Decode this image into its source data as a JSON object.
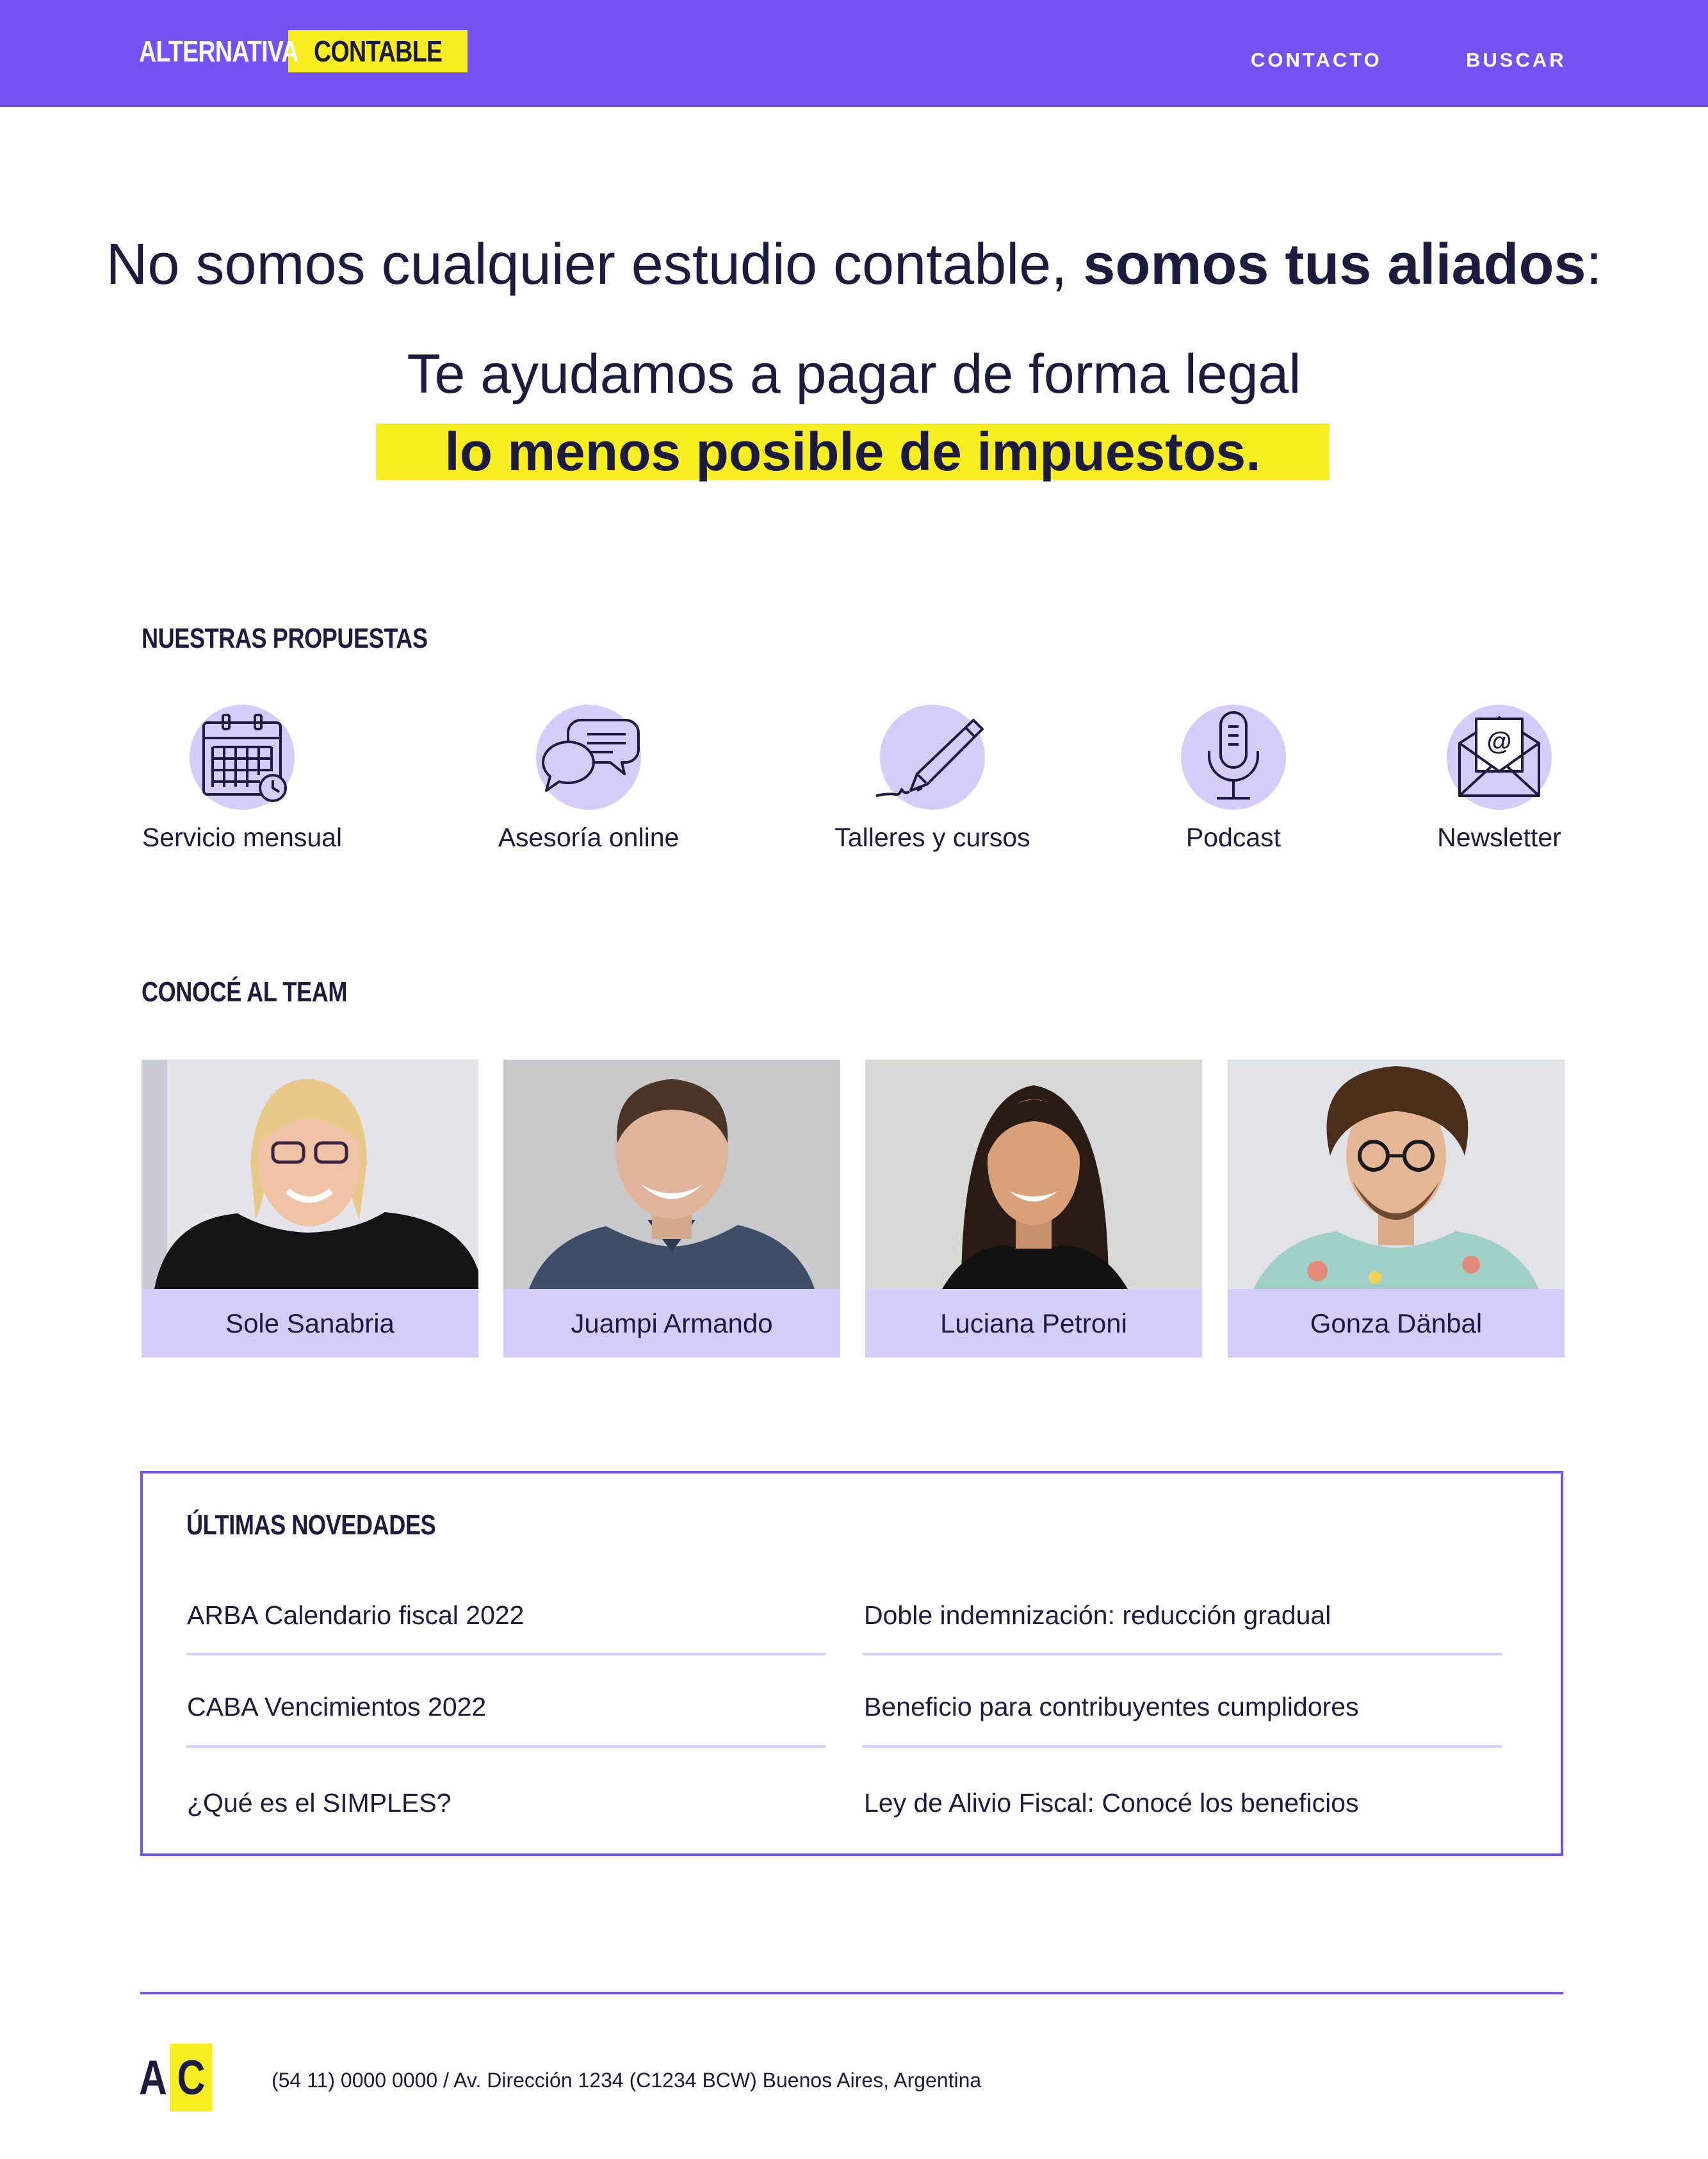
{
  "colors": {
    "brand_purple": "#7552ef",
    "highlight_yellow": "#f8ee22",
    "light_purple": "#d6ccfb",
    "text_dark": "#1c1a3d"
  },
  "header": {
    "logo_left": "ALTERNATIVA",
    "logo_right": "CONTABLE",
    "nav": [
      "CONTACTO",
      "BUSCAR"
    ]
  },
  "hero": {
    "line1_regular": "No somos cualquier estudio contable, ",
    "line1_bold": "somos tus aliados",
    "line1_colon": ":",
    "line2": "Te ayudamos a pagar de forma legal",
    "highlight": "lo menos posible de impuestos."
  },
  "services": {
    "title": "NUESTRAS PROPUESTAS",
    "items": [
      {
        "label": "Servicio mensual",
        "icon": "calendar-icon"
      },
      {
        "label": "Asesoría online",
        "icon": "chat-bubbles-icon"
      },
      {
        "label": "Talleres y cursos",
        "icon": "pencil-icon"
      },
      {
        "label": "Podcast",
        "icon": "microphone-icon"
      },
      {
        "label": "Newsletter",
        "icon": "envelope-icon"
      }
    ]
  },
  "team": {
    "title": "CONOCÉ AL TEAM",
    "members": [
      {
        "name": "Sole Sanabria"
      },
      {
        "name": "Juampi Armando"
      },
      {
        "name": "Luciana Petroni"
      },
      {
        "name": "Gonza Dänbal"
      }
    ]
  },
  "news": {
    "title": "ÚLTIMAS NOVEDADES",
    "items": [
      "ARBA Calendario fiscal 2022",
      "Doble indemnización: reducción gradual",
      "CABA Vencimientos 2022",
      "Beneficio para contribuyentes cumplidores",
      "¿Qué es el SIMPLES?",
      "Ley de Alivio Fiscal: Conocé los beneficios"
    ]
  },
  "footer": {
    "logo_a": "A",
    "logo_c": "C",
    "contact": "(54 11) 0000 0000 / Av. Dirección 1234 (C1234 BCW) Buenos Aires, Argentina"
  }
}
